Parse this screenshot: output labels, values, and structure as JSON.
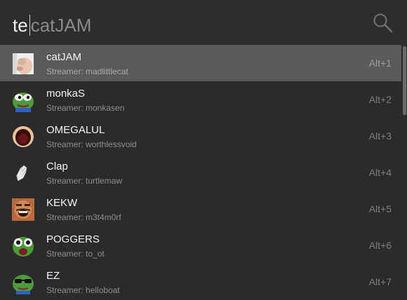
{
  "search": {
    "typed_text": "te",
    "suggestion_text": "catJAM"
  },
  "results": [
    {
      "name": "catJAM",
      "streamer": "Streamer: madlittlecat",
      "shortcut": "Alt+1",
      "icon": "cat-emote-icon"
    },
    {
      "name": "monkaS",
      "streamer": "Streamer: monkasen",
      "shortcut": "Alt+2",
      "icon": "pepe-frog-icon"
    },
    {
      "name": "OMEGALUL",
      "streamer": "Streamer: worthlessvoid",
      "shortcut": "Alt+3",
      "icon": "omegalul-face-icon"
    },
    {
      "name": "Clap",
      "streamer": "Streamer: turtlemaw",
      "shortcut": "Alt+4",
      "icon": "clapping-hand-icon"
    },
    {
      "name": "KEKW",
      "streamer": "Streamer: m3t4m0rf",
      "shortcut": "Alt+5",
      "icon": "laughing-man-icon"
    },
    {
      "name": "POGGERS",
      "streamer": "Streamer: to_ot",
      "shortcut": "Alt+6",
      "icon": "poggers-frog-icon"
    },
    {
      "name": "EZ",
      "streamer": "Streamer: helloboat",
      "shortcut": "Alt+7",
      "icon": "ez-frog-sunglasses-icon"
    }
  ],
  "colors": {
    "background": "#2b2b2b",
    "selected_row": "#5a5a5a",
    "primary_text": "#f4f4f4",
    "secondary_text": "#8e8e8e"
  }
}
